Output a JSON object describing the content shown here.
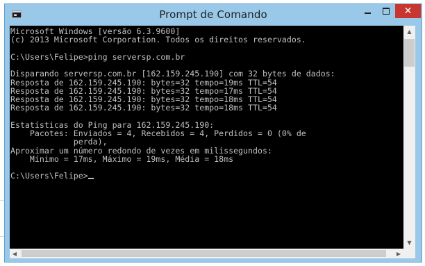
{
  "window": {
    "title": "Prompt de Comando",
    "close_glyph": "✕",
    "icon": "cmd-icon"
  },
  "console": {
    "lines": [
      "Microsoft Windows [versão 6.3.9600]",
      "(c) 2013 Microsoft Corporation. Todos os direitos reservados.",
      "",
      "C:\\Users\\Felipe>ping serversp.com.br",
      "",
      "Disparando serversp.com.br [162.159.245.190] com 32 bytes de dados:",
      "Resposta de 162.159.245.190: bytes=32 tempo=19ms TTL=54",
      "Resposta de 162.159.245.190: bytes=32 tempo=17ms TTL=54",
      "Resposta de 162.159.245.190: bytes=32 tempo=18ms TTL=54",
      "Resposta de 162.159.245.190: bytes=32 tempo=18ms TTL=54",
      "",
      "Estatísticas do Ping para 162.159.245.190:",
      "    Pacotes: Enviados = 4, Recebidos = 4, Perdidos = 0 (0% de",
      "             perda),",
      "Aproximar um número redondo de vezes em milissegundos:",
      "    Mínimo = 17ms, Máximo = 19ms, Média = 18ms",
      "",
      "C:\\Users\\Felipe>"
    ]
  },
  "scrollbars": {
    "up_arrow": "▲",
    "down_arrow": "▼",
    "left_arrow": "◀",
    "right_arrow": "▶"
  },
  "colors": {
    "titlebar": "#99c8e8",
    "close_button": "#c7372f",
    "console_bg": "#000000",
    "console_fg": "#c0c0c0"
  }
}
